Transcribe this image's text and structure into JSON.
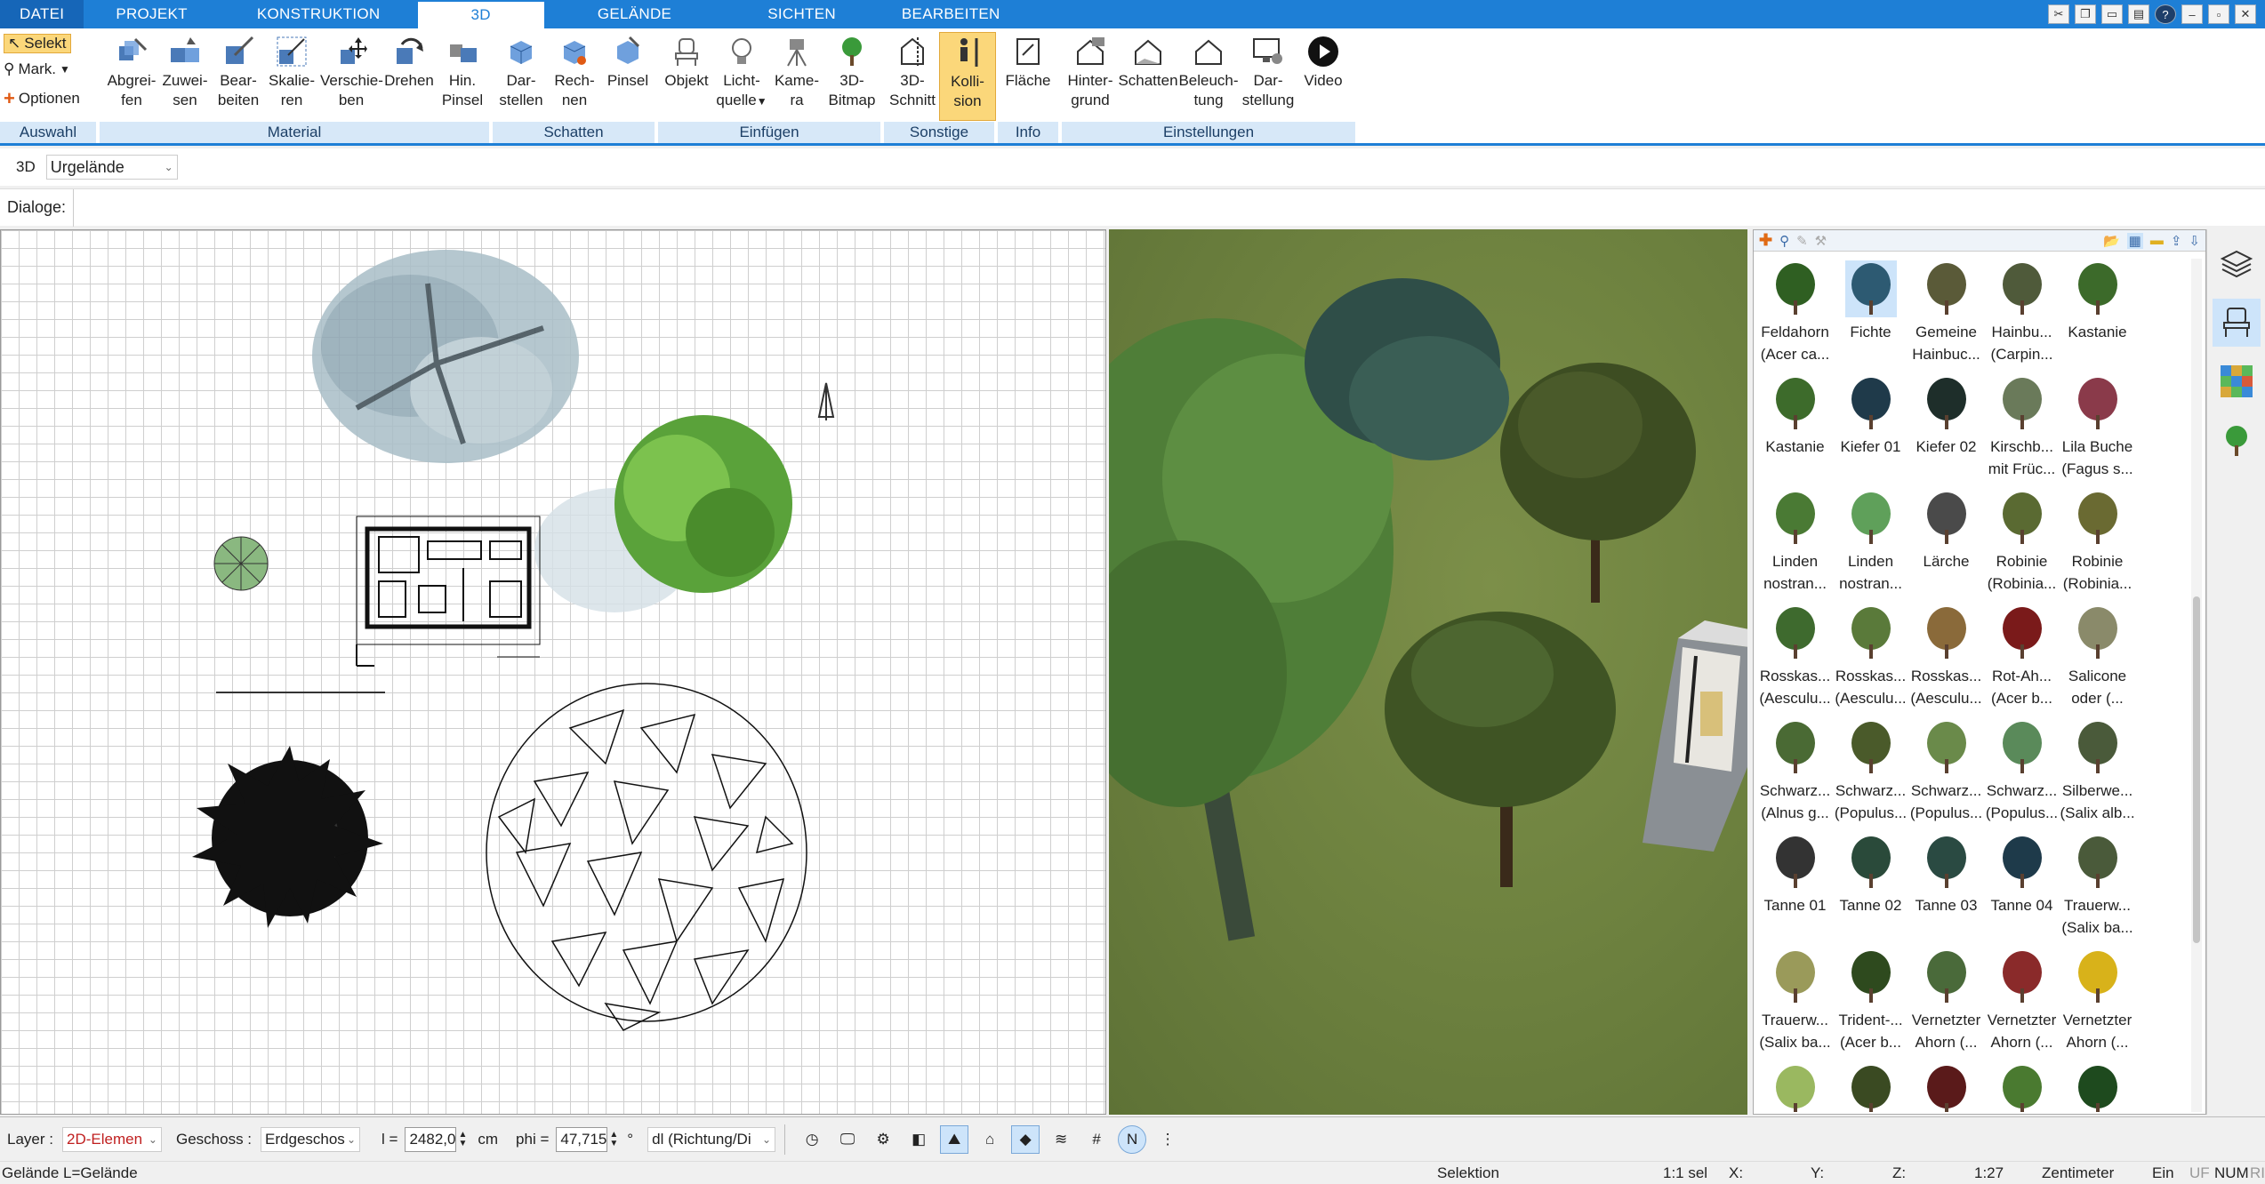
{
  "tabs": [
    {
      "label": "DATEI"
    },
    {
      "label": "PROJEKT"
    },
    {
      "label": "KONSTRUKTION"
    },
    {
      "label": "3D"
    },
    {
      "label": "GELÄNDE"
    },
    {
      "label": "SICHTEN"
    },
    {
      "label": "BEARBEITEN"
    }
  ],
  "ribbon": {
    "auswahl": {
      "label": "Auswahl",
      "selekt": "Selekt",
      "mark": "Mark.",
      "optionen": "Optionen"
    },
    "material": {
      "label": "Material",
      "buttons": [
        {
          "l1": "Abgrei-",
          "l2": "fen"
        },
        {
          "l1": "Zuwei-",
          "l2": "sen"
        },
        {
          "l1": "Bear-",
          "l2": "beiten"
        },
        {
          "l1": "Skalie-",
          "l2": "ren"
        },
        {
          "l1": "Verschie-",
          "l2": "ben"
        },
        {
          "l1": "Drehen",
          "l2": ""
        },
        {
          "l1": "Hin.",
          "l2": "Pinsel"
        }
      ]
    },
    "schatten": {
      "label": "Schatten",
      "buttons": [
        {
          "l1": "Dar-",
          "l2": "stellen"
        },
        {
          "l1": "Rech-",
          "l2": "nen"
        },
        {
          "l1": "Pinsel",
          "l2": ""
        }
      ]
    },
    "einfuegen": {
      "label": "Einfügen",
      "buttons": [
        {
          "l1": "Objekt",
          "l2": ""
        },
        {
          "l1": "Licht-",
          "l2": "quelle"
        },
        {
          "l1": "Kame-",
          "l2": "ra"
        },
        {
          "l1": "3D-",
          "l2": "Bitmap"
        }
      ]
    },
    "sonstige": {
      "label": "Sonstige",
      "buttons": [
        {
          "l1": "3D-",
          "l2": "Schnitt"
        },
        {
          "l1": "Kolli-",
          "l2": "sion"
        }
      ]
    },
    "info": {
      "label": "Info",
      "buttons": [
        {
          "l1": "Fläche",
          "l2": ""
        }
      ]
    },
    "einstellungen": {
      "label": "Einstellungen",
      "buttons": [
        {
          "l1": "Hinter-",
          "l2": "grund"
        },
        {
          "l1": "Schatten",
          "l2": ""
        },
        {
          "l1": "Beleuch-",
          "l2": "tung"
        },
        {
          "l1": "Dar-",
          "l2": "stellung"
        },
        {
          "l1": "Video",
          "l2": ""
        }
      ]
    }
  },
  "options": {
    "mode": "3D",
    "terrain": "Urgelände"
  },
  "dialogs": {
    "label": "Dialoge:"
  },
  "library": {
    "items": [
      {
        "l1": "Feldahorn",
        "l2": "(Acer ca...",
        "color": "#2f5f22"
      },
      {
        "l1": "Fichte",
        "l2": "",
        "color": "#2d5a72",
        "selected": true
      },
      {
        "l1": "Gemeine",
        "l2": "Hainbuc...",
        "color": "#5a5a38"
      },
      {
        "l1": "Hainbu...",
        "l2": "(Carpin...",
        "color": "#4f5a3a"
      },
      {
        "l1": "Kastanie",
        "l2": "",
        "color": "#3c6a2a"
      },
      {
        "l1": "Kastanie",
        "l2": "",
        "color": "#3d6b2b"
      },
      {
        "l1": "Kiefer 01",
        "l2": "",
        "color": "#1f3a4a"
      },
      {
        "l1": "Kiefer 02",
        "l2": "",
        "color": "#1e2e2a"
      },
      {
        "l1": "Kirschb...",
        "l2": "mit Früc...",
        "color": "#6a7a5a"
      },
      {
        "l1": "Lila Buche",
        "l2": "(Fagus s...",
        "color": "#8a3a4a"
      },
      {
        "l1": "Linden",
        "l2": "nostran...",
        "color": "#4a7a34"
      },
      {
        "l1": "Linden",
        "l2": "nostran...",
        "color": "#5fa05a"
      },
      {
        "l1": "Lärche",
        "l2": "",
        "color": "#4a4a4a"
      },
      {
        "l1": "Robinie",
        "l2": "(Robinia...",
        "color": "#5a6a32"
      },
      {
        "l1": "Robinie",
        "l2": "(Robinia...",
        "color": "#6a6a32"
      },
      {
        "l1": "Rosskas...",
        "l2": "(Aesculu...",
        "color": "#3e6a2e"
      },
      {
        "l1": "Rosskas...",
        "l2": "(Aesculu...",
        "color": "#5a7a3a"
      },
      {
        "l1": "Rosskas...",
        "l2": "(Aesculu...",
        "color": "#8a6a3a"
      },
      {
        "l1": "Rot-Ah...",
        "l2": "(Acer b...",
        "color": "#7a1a1a"
      },
      {
        "l1": "Salicone",
        "l2": "oder (...",
        "color": "#8a8a6a"
      },
      {
        "l1": "Schwarz...",
        "l2": "(Alnus g...",
        "color": "#4a6a34"
      },
      {
        "l1": "Schwarz...",
        "l2": "(Populus...",
        "color": "#4a5a2a"
      },
      {
        "l1": "Schwarz...",
        "l2": "(Populus...",
        "color": "#6a8a4a"
      },
      {
        "l1": "Schwarz...",
        "l2": "(Populus...",
        "color": "#5a8a5a"
      },
      {
        "l1": "Silberwe...",
        "l2": "(Salix alb...",
        "color": "#4a5a3a"
      },
      {
        "l1": "Tanne 01",
        "l2": "",
        "color": "#333333"
      },
      {
        "l1": "Tanne 02",
        "l2": "",
        "color": "#2a4a3a"
      },
      {
        "l1": "Tanne 03",
        "l2": "",
        "color": "#2a4a42"
      },
      {
        "l1": "Tanne 04",
        "l2": "",
        "color": "#1e3a4a"
      },
      {
        "l1": "Trauerw...",
        "l2": "(Salix ba...",
        "color": "#4a5a3a"
      },
      {
        "l1": "Trauerw...",
        "l2": "(Salix ba...",
        "color": "#9a9a5a"
      },
      {
        "l1": "Trident-...",
        "l2": "(Acer b...",
        "color": "#2e4a1e"
      },
      {
        "l1": "Vernetzter",
        "l2": "Ahorn (...",
        "color": "#4a6a3a"
      },
      {
        "l1": "Vernetzter",
        "l2": "Ahorn (...",
        "color": "#8a2a2a"
      },
      {
        "l1": "Vernetzter",
        "l2": "Ahorn (...",
        "color": "#d8b21a"
      },
      {
        "l1": "",
        "l2": "",
        "color": "#9ab860"
      },
      {
        "l1": "",
        "l2": "",
        "color": "#3a4a22"
      },
      {
        "l1": "",
        "l2": "",
        "color": "#5a1a1a"
      },
      {
        "l1": "",
        "l2": "",
        "color": "#4a7a30"
      },
      {
        "l1": "",
        "l2": "",
        "color": "#1e4a1e"
      }
    ]
  },
  "status": {
    "layer_label": "Layer :",
    "layer_value": "2D-Elemen",
    "geschoss_label": "Geschoss :",
    "geschoss_value": "Erdgeschos",
    "l_label": "l =",
    "l_value": "2482,0",
    "l_unit": "cm",
    "phi_label": "phi =",
    "phi_value": "47,715",
    "phi_unit": "°",
    "dl_value": "dl (Richtung/Di",
    "info": "Gelände L=Gelände",
    "mode": "Selektion",
    "sel": "1:1 sel",
    "x": "X:",
    "y": "Y:",
    "z": "Z:",
    "scale": "1:27",
    "unit": "Zentimeter",
    "ein": "Ein",
    "uf": "UF",
    "num": "NUM",
    "ri": "RI"
  },
  "colors": {
    "accent": "#1e7fd6",
    "selected": "#fbd77a",
    "panel_label": "#d7e8f8"
  }
}
